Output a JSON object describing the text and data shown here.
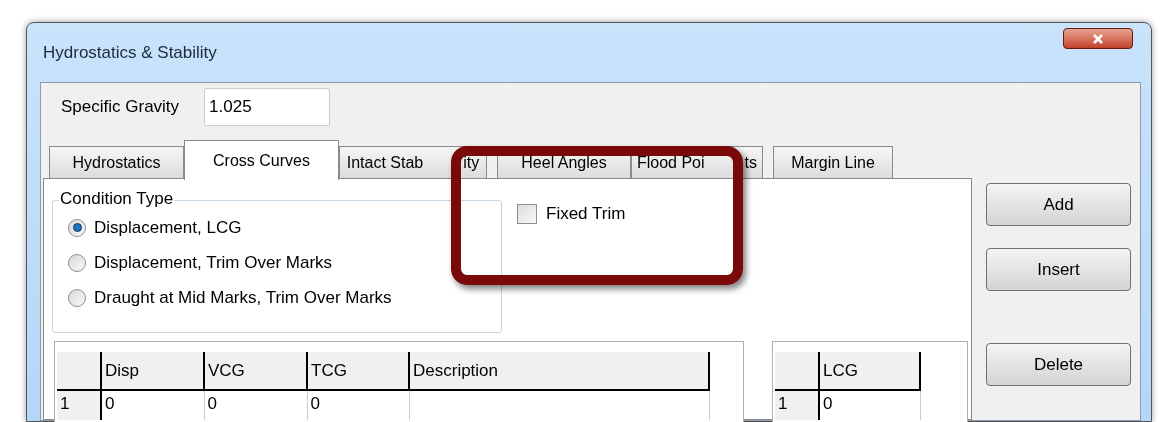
{
  "window": {
    "title": "Hydrostatics & Stability"
  },
  "specific_gravity": {
    "label": "Specific Gravity",
    "value": "1.025"
  },
  "tabs": [
    {
      "label": "Hydrostatics",
      "selected": false
    },
    {
      "label": "Cross Curves",
      "selected": true
    },
    {
      "label_parts": [
        "Intact Stab",
        "ity"
      ],
      "selected": false
    },
    {
      "label": "Heel Angles",
      "selected": false
    },
    {
      "label_parts": [
        "Flood Poi",
        "ts"
      ],
      "selected": false
    },
    {
      "label": "Margin Line",
      "selected": false
    }
  ],
  "condition_type": {
    "title": "Condition Type",
    "options": [
      {
        "label": "Displacement, LCG",
        "selected": true
      },
      {
        "label": "Displacement, Trim Over Marks",
        "selected": false
      },
      {
        "label": "Draught at Mid Marks, Trim Over Marks",
        "selected": false
      }
    ]
  },
  "fixed_trim": {
    "label": "Fixed Trim",
    "checked": false
  },
  "buttons": [
    "Add",
    "Insert",
    "Delete"
  ],
  "table": {
    "columns": [
      "Disp",
      "VCG",
      "TCG",
      "Description"
    ],
    "rows": [
      {
        "index": "1",
        "cells": [
          "0",
          "0",
          "0",
          ""
        ]
      }
    ]
  },
  "lcg_table": {
    "columns": [
      "LCG"
    ],
    "rows": [
      {
        "index": "1",
        "cells": [
          "0"
        ]
      }
    ]
  }
}
